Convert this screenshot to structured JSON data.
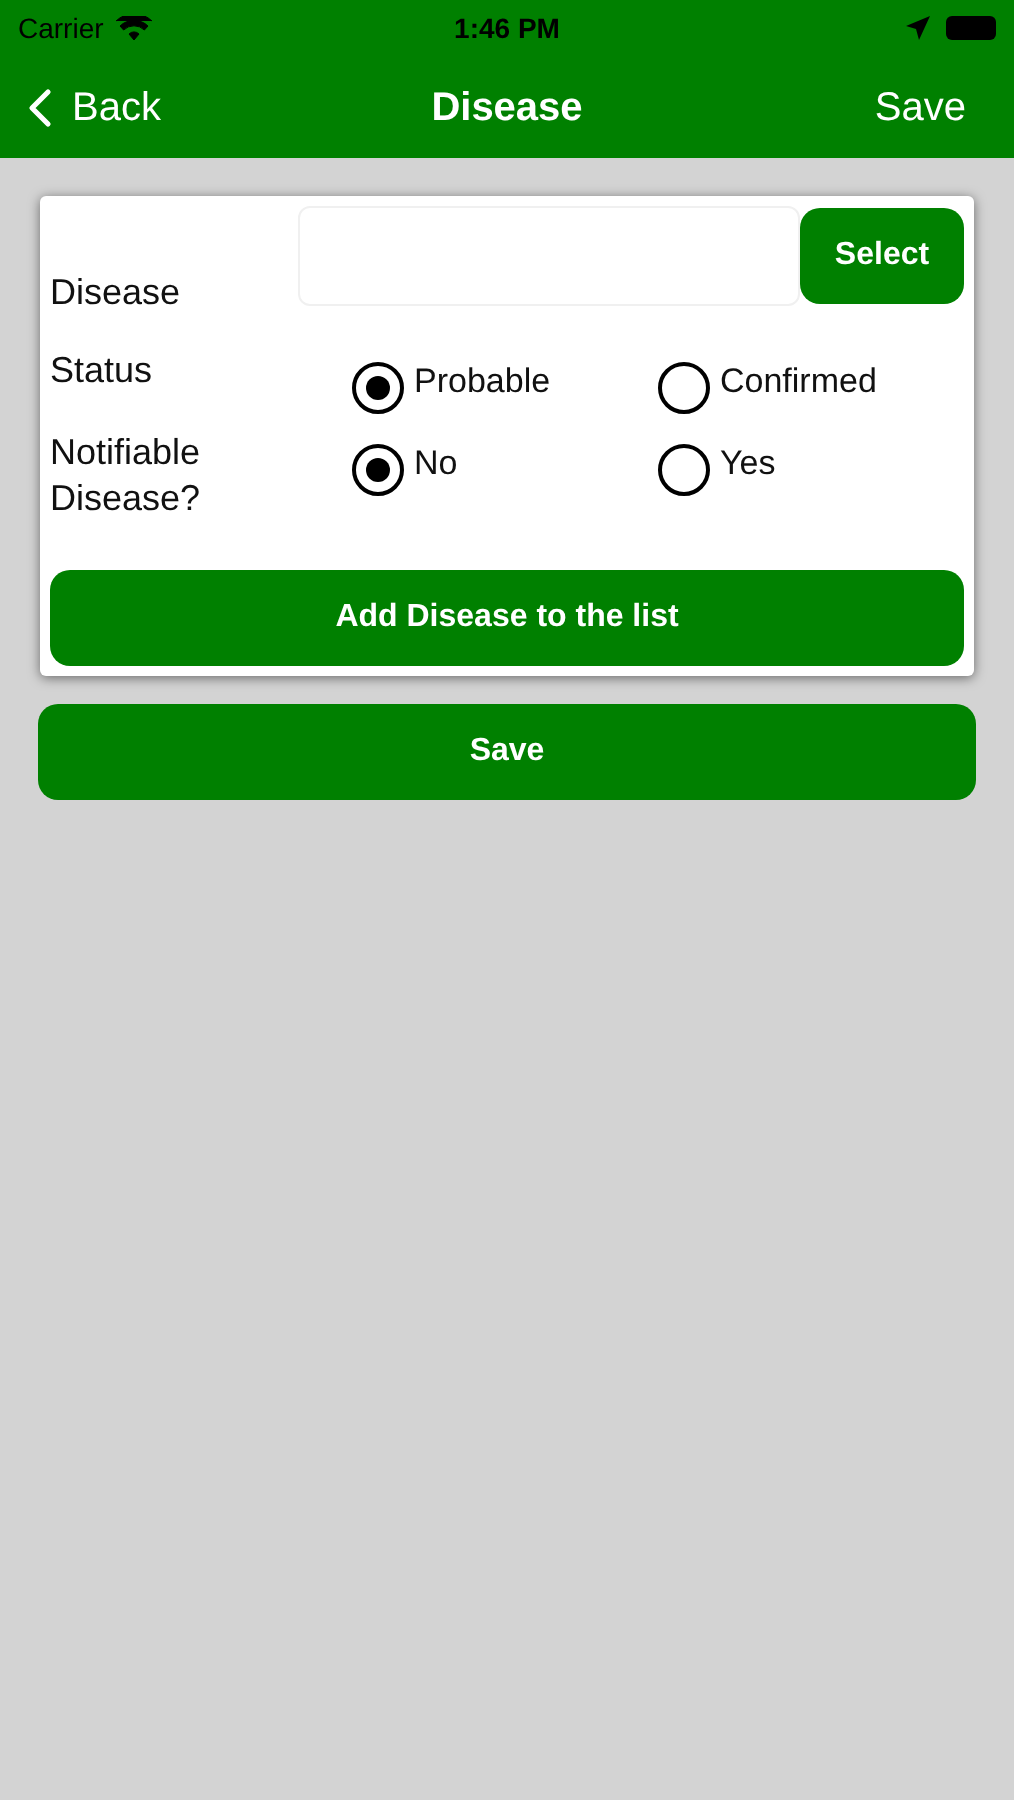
{
  "status_bar": {
    "carrier": "Carrier",
    "time": "1:46 PM"
  },
  "nav_bar": {
    "back": "Back",
    "title": "Disease",
    "action": "Save"
  },
  "form": {
    "disease_label": "Disease",
    "select_button": "Select",
    "radio_groups": [
      {
        "label": "Status",
        "options": [
          {
            "label": "Probable",
            "selected": true
          },
          {
            "label": "Confirmed",
            "selected": false
          }
        ]
      },
      {
        "label": "Notifiable Disease?",
        "options": [
          {
            "label": "No",
            "selected": true
          },
          {
            "label": "Yes",
            "selected": false
          }
        ]
      }
    ],
    "add_button": "Add Disease to the list"
  },
  "save_button": "Save"
}
